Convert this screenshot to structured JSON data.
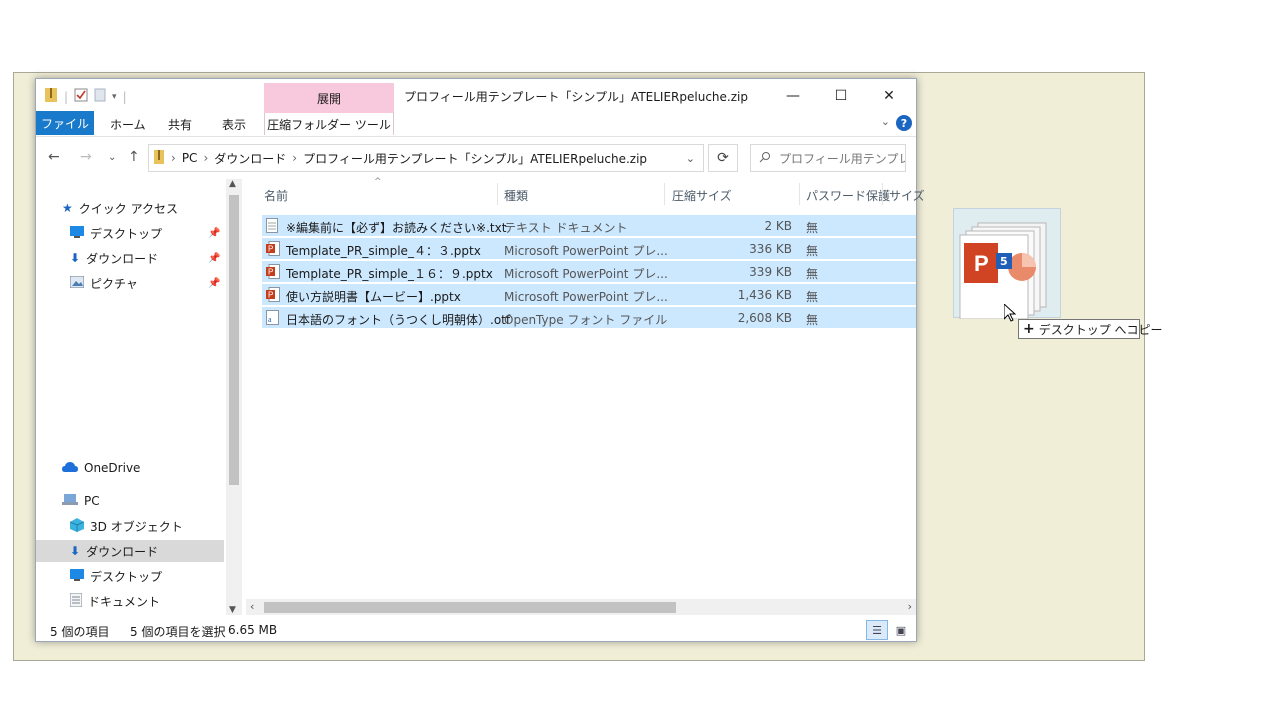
{
  "window": {
    "title": "プロフィール用テンプレート「シンプル」ATELIERpeluche.zip",
    "context_tab_header": "展開",
    "controls": {
      "minimize": "—",
      "maximize": "☐",
      "close": "✕"
    }
  },
  "ribbon": {
    "tabs": [
      {
        "label": "ファイル"
      },
      {
        "label": "ホーム"
      },
      {
        "label": "共有"
      },
      {
        "label": "表示"
      },
      {
        "label": "圧縮フォルダー ツール"
      }
    ],
    "help": "?"
  },
  "address": {
    "segments": [
      "PC",
      "ダウンロード",
      "プロフィール用テンプレート「シンプル」ATELIERpeluche.zip"
    ],
    "search_placeholder": "プロフィール用テンプレ..."
  },
  "nav_pane": {
    "items": [
      {
        "label": "クイック アクセス",
        "icon": "star-icon",
        "pinned": false
      },
      {
        "label": "デスクトップ",
        "icon": "desktop-icon",
        "pinned": true
      },
      {
        "label": "ダウンロード",
        "icon": "download-icon",
        "pinned": true
      },
      {
        "label": "ピクチャ",
        "icon": "pictures-icon",
        "pinned": true
      },
      {
        "label": "OneDrive",
        "icon": "cloud-icon",
        "pinned": false
      },
      {
        "label": "PC",
        "icon": "pc-icon",
        "pinned": false
      },
      {
        "label": "3D オブジェクト",
        "icon": "cube-icon",
        "pinned": false
      },
      {
        "label": "ダウンロード",
        "icon": "download-icon",
        "pinned": false,
        "selected": true
      },
      {
        "label": "デスクトップ",
        "icon": "desktop-icon",
        "pinned": false
      },
      {
        "label": "ドキュメント",
        "icon": "document-icon",
        "pinned": false
      }
    ]
  },
  "file_list": {
    "columns": [
      "名前",
      "種類",
      "圧縮サイズ",
      "パスワード保護",
      "サイズ"
    ],
    "rows": [
      {
        "name": "※編集前に【必ず】お読みください※.txt",
        "type": "テキスト ドキュメント",
        "size": "2 KB",
        "password": "無",
        "icon": "text-file-icon"
      },
      {
        "name": "Template_PR_simple_４：３.pptx",
        "type": "Microsoft PowerPoint プレ...",
        "size": "336 KB",
        "password": "無",
        "icon": "powerpoint-file-icon"
      },
      {
        "name": "Template_PR_simple_１６：９.pptx",
        "type": "Microsoft PowerPoint プレ...",
        "size": "339 KB",
        "password": "無",
        "icon": "powerpoint-file-icon"
      },
      {
        "name": "使い方説明書【ムービー】.pptx",
        "type": "Microsoft PowerPoint プレ...",
        "size": "1,436 KB",
        "password": "無",
        "icon": "powerpoint-file-icon"
      },
      {
        "name": "日本語のフォント（うつくし明朝体）.otf",
        "type": "OpenType フォント ファイル",
        "size": "2,608 KB",
        "password": "無",
        "icon": "font-file-icon"
      }
    ]
  },
  "status": {
    "count": "5 個の項目",
    "selection": "5 個の項目を選択",
    "size": "6.65 MB"
  },
  "drag": {
    "tooltip": "デスクトップ へコピー",
    "plus": "+",
    "badge": "5"
  },
  "colors": {
    "accent": "#1979ca",
    "selection": "#cce8ff",
    "context_tab": "#f8c8dc",
    "desktop": "#f1eed8"
  }
}
